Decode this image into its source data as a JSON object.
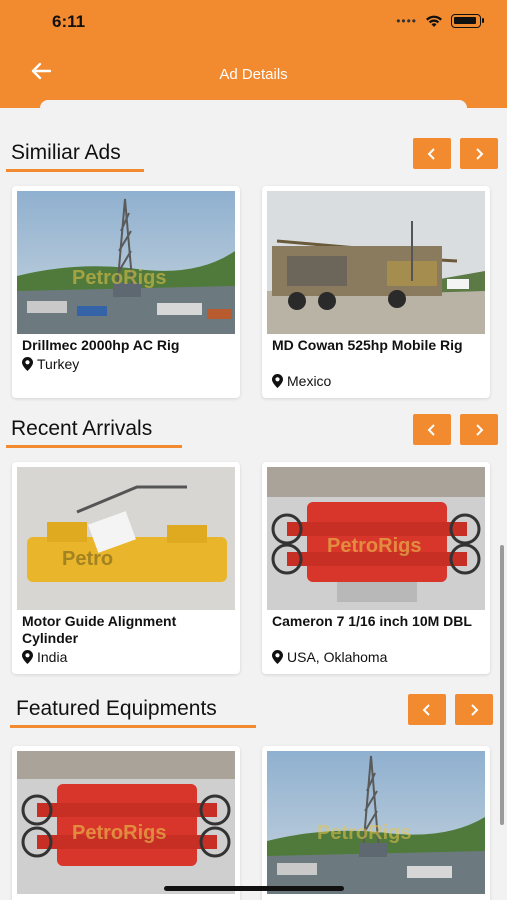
{
  "status": {
    "time": "6:11"
  },
  "header": {
    "title": "Ad Details",
    "back_icon": "arrow-left-icon"
  },
  "colors": {
    "accent": "#f28a30",
    "background": "#f2f2f2"
  },
  "sections": [
    {
      "title": "Similiar Ads",
      "cards": [
        {
          "title": "Drillmec 2000hp AC Rig",
          "location": "Turkey",
          "image": "drilling-rig-photo"
        },
        {
          "title": "MD Cowan 525hp Mobile Rig",
          "location": "Mexico",
          "image": "mobile-rig-truck-photo"
        }
      ]
    },
    {
      "title": "Recent Arrivals",
      "cards": [
        {
          "title": "Motor Guide Alignment Cylinder",
          "location": "India",
          "image": "yellow-cylinder-photo"
        },
        {
          "title": "Cameron 7 1/16 inch 10M DBL",
          "location": "USA, Oklahoma",
          "image": "red-bop-photo"
        }
      ]
    },
    {
      "title": "Featured Equipments",
      "cards": [
        {
          "title": "",
          "location": "",
          "image": "red-bop-photo"
        },
        {
          "title": "",
          "location": "",
          "image": "drilling-rig-photo"
        }
      ]
    }
  ],
  "watermark": "PetroRigs"
}
